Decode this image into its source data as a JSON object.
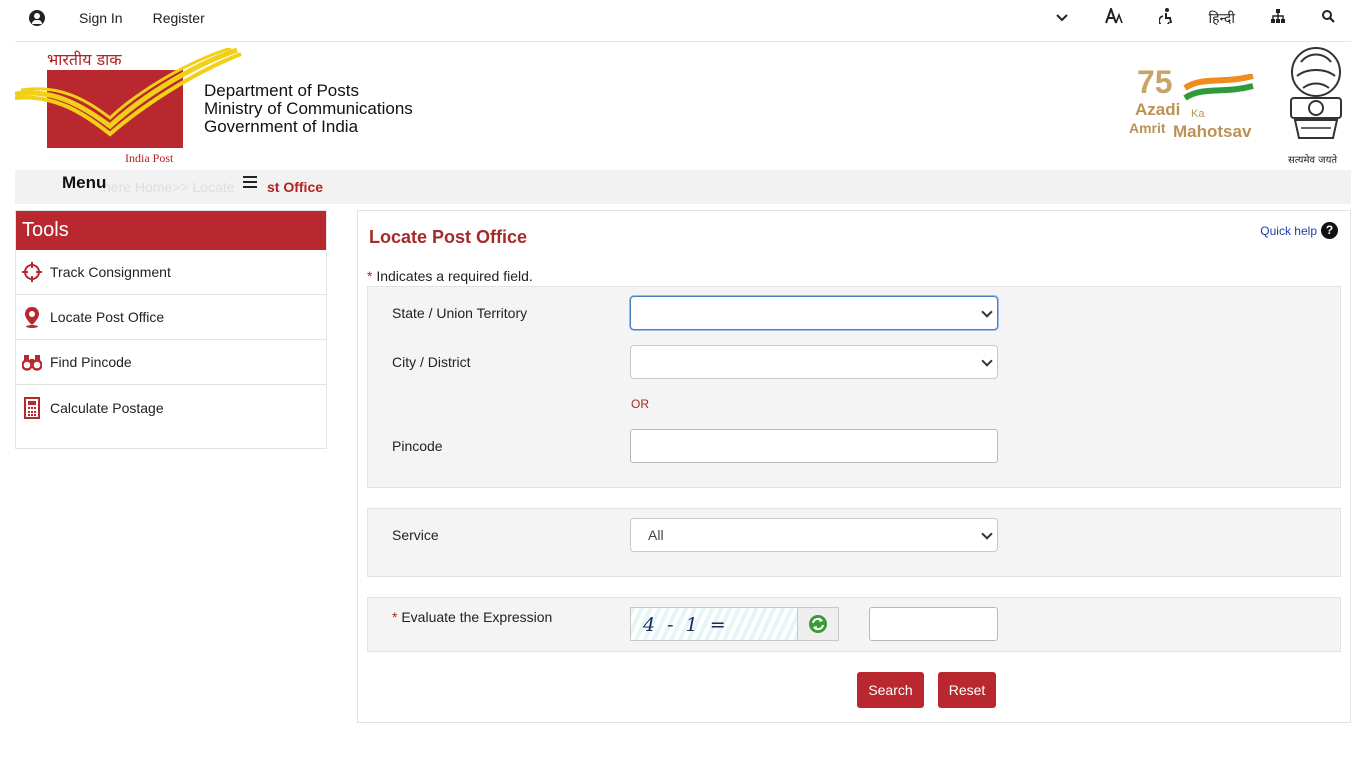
{
  "topbar": {
    "sign_in": "Sign In",
    "register": "Register",
    "hindi": "हिन्दी",
    "icons": [
      "user-icon",
      "chevron-down-icon",
      "text-size-icon",
      "accessibility-icon",
      "sitemap-icon",
      "search-icon"
    ]
  },
  "header": {
    "logo_top": "भारतीय डाक",
    "logo_bottom": "India Post",
    "dept_line1": "Department of Posts",
    "dept_line2": "Ministry of Communications",
    "dept_line3": "Government of India",
    "azadi_75": "75",
    "azadi_word": "Azadi",
    "azadi_ka": "Ka",
    "azadi_amrit": "Amrit",
    "azadi_mahotsav": "Mahotsav",
    "emblem_motto": "सत्यमेव जयते"
  },
  "menubar": {
    "menu_label": "Menu",
    "faded_crumb": "here Home>> Locate",
    "crumb_end": "st Office"
  },
  "tools": {
    "title": "Tools",
    "items": [
      {
        "label": "Track Consignment",
        "icon": "crosshair-icon"
      },
      {
        "label": "Locate Post Office",
        "icon": "map-pin-icon"
      },
      {
        "label": "Find Pincode",
        "icon": "binoculars-icon"
      },
      {
        "label": "Calculate Postage",
        "icon": "calculator-icon"
      }
    ]
  },
  "main": {
    "heading": "Locate Post Office",
    "quick_help": "Quick help",
    "required_star": "*",
    "required_note": " Indicates a required field.",
    "state_label": "State / Union Territory",
    "state_value": "",
    "city_label": "City / District",
    "city_value": "",
    "or_text": "OR",
    "pincode_label": "Pincode",
    "pincode_value": "",
    "service_label": "Service",
    "service_value": "All",
    "captcha_label": "Evaluate the Expression",
    "captcha_text": "4 - 1 =",
    "captcha_answer": "",
    "search_button": "Search",
    "reset_button": "Reset"
  },
  "colors": {
    "brand_red": "#b8282e",
    "heading_red": "#a52a2a",
    "link_blue": "#1a3ea8"
  }
}
